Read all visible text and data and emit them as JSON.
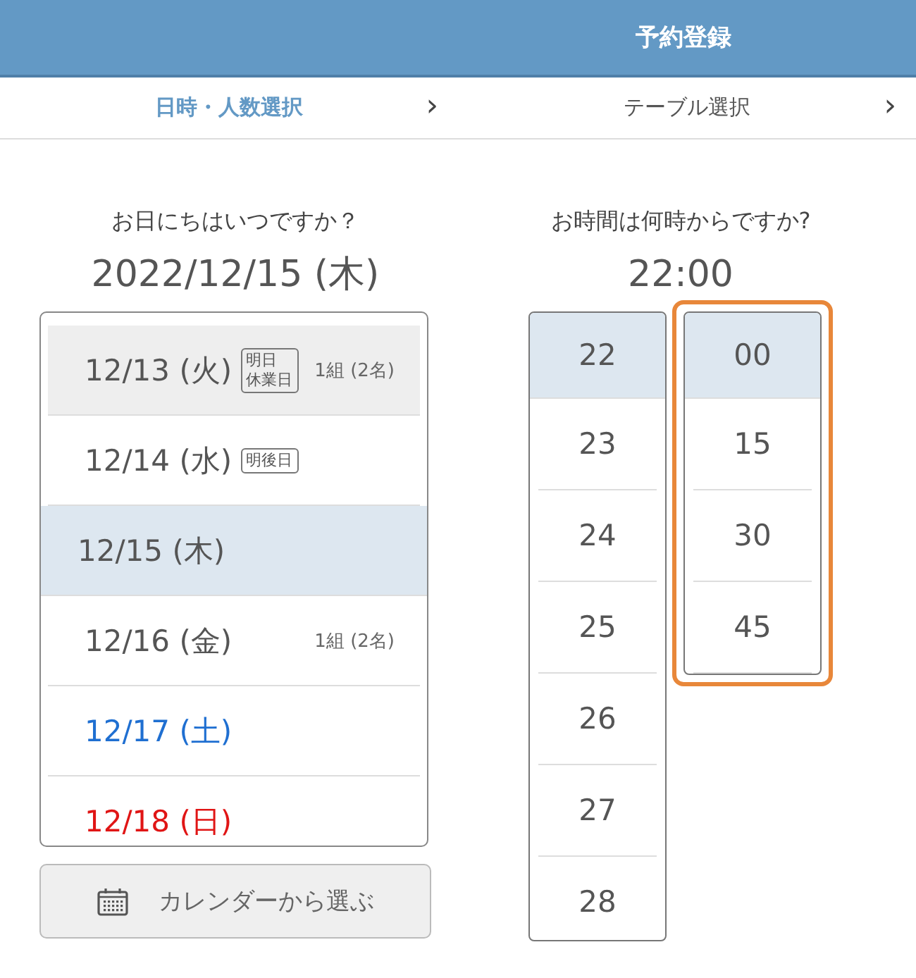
{
  "header": {
    "title": "予約登録"
  },
  "steps": [
    {
      "label": "日時・人数選択",
      "selected": true,
      "chevron": "›"
    },
    {
      "label": "テーブル選択",
      "selected": false,
      "chevron": "›"
    }
  ],
  "date_picker": {
    "question": "お日にちはいつですか？",
    "value": "2022/12/15 (木)",
    "days": [
      {
        "date": "12/13 (火)",
        "kind": "weekday",
        "badge": [
          "明日",
          "休業日"
        ],
        "count": "1組 (2名)",
        "disabled": true,
        "selected": false
      },
      {
        "date": "12/14 (水)",
        "kind": "weekday",
        "badge": [
          "明後日"
        ],
        "disabled": false,
        "selected": false
      },
      {
        "date": "12/15 (木)",
        "kind": "weekday",
        "disabled": false,
        "selected": true
      },
      {
        "date": "12/16 (金)",
        "kind": "weekday",
        "count": "1組 (2名)",
        "disabled": false,
        "selected": false
      },
      {
        "date": "12/17 (土)",
        "kind": "saturday",
        "disabled": false,
        "selected": false
      },
      {
        "date": "12/18 (日)",
        "kind": "sunday",
        "disabled": false,
        "selected": false
      }
    ],
    "calendar_button": "カレンダーから選ぶ"
  },
  "time_picker": {
    "question": "お時間は何時からですか?",
    "value": "22:00",
    "hours": {
      "focused": false,
      "items": [
        {
          "label": "22",
          "selected": true
        },
        {
          "label": "23",
          "selected": false
        },
        {
          "label": "24",
          "selected": false
        },
        {
          "label": "25",
          "selected": false
        },
        {
          "label": "26",
          "selected": false
        },
        {
          "label": "27",
          "selected": false
        },
        {
          "label": "28",
          "selected": false
        }
      ]
    },
    "minutes": {
      "focused": true,
      "items": [
        {
          "label": "00",
          "selected": true
        },
        {
          "label": "15",
          "selected": false
        },
        {
          "label": "30",
          "selected": false
        },
        {
          "label": "45",
          "selected": false
        }
      ]
    }
  }
}
